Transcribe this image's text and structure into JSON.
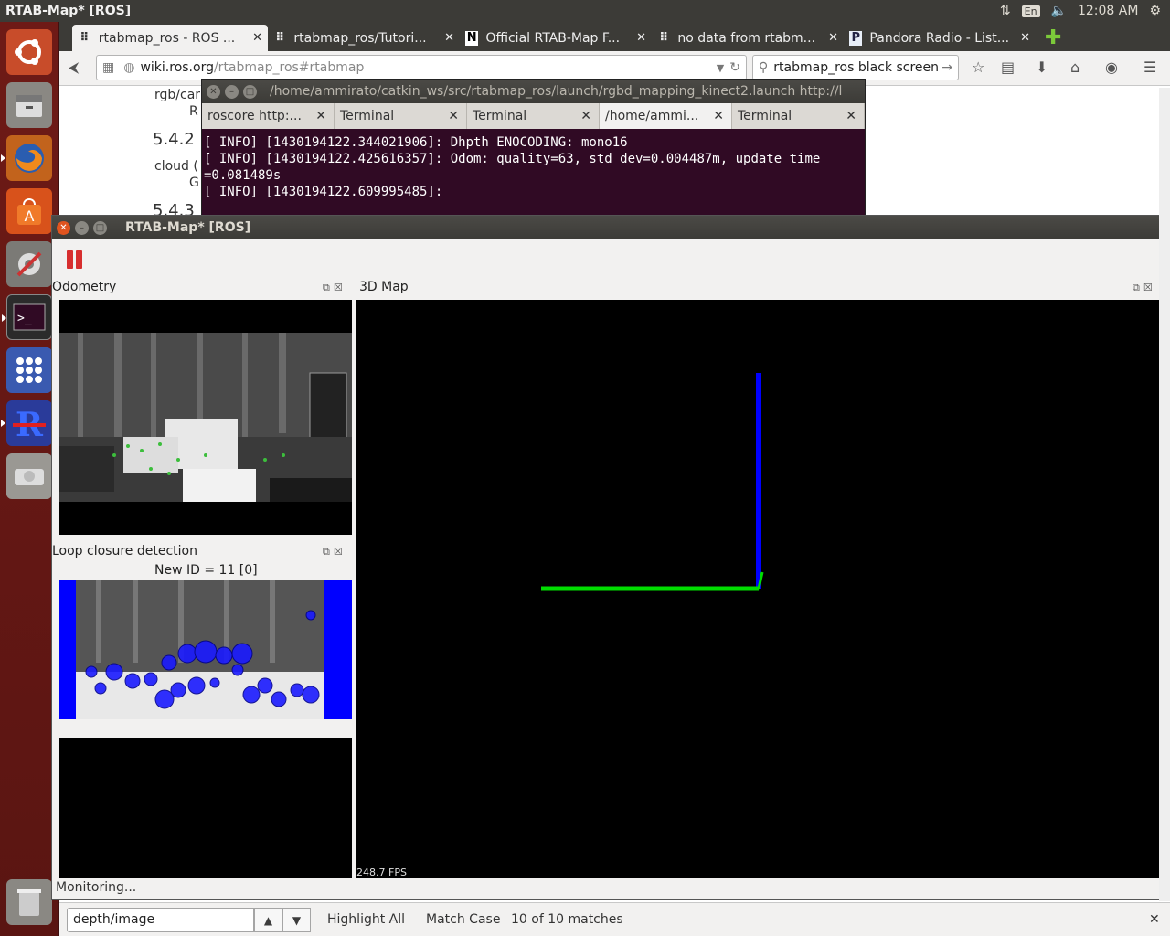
{
  "top_panel": {
    "app_title": "RTAB-Map* [ROS]",
    "keyboard": "En",
    "time": "12:08 AM"
  },
  "browser": {
    "tabs": [
      {
        "label": "rtabmap_ros - ROS ...",
        "icon": "ros-grid-icon"
      },
      {
        "label": "rtabmap_ros/Tutori...",
        "icon": "ros-grid-icon"
      },
      {
        "label": "Official RTAB-Map F...",
        "icon": "nabble-icon"
      },
      {
        "label": "no data from rtabm...",
        "icon": "ros-grid-icon"
      },
      {
        "label": "Pandora Radio - List...",
        "icon": "pandora-icon"
      }
    ],
    "url": "wiki.ros.org/rtabmap_ros#rtabmap",
    "url_domain": "wiki.ros.org",
    "url_path": "/rtabmap_ros#rtabmap",
    "search_value": "rtabmap_ros black screen",
    "page_fragments": [
      "rgb/car",
      "R",
      "5.4.2 F",
      "cloud (",
      "G",
      "5.4.3 F"
    ]
  },
  "terminal": {
    "title": "/home/ammirato/catkin_ws/src/rtabmap_ros/launch/rgbd_mapping_kinect2.launch http://l",
    "tabs": [
      "roscore http:...",
      "Terminal",
      "Terminal",
      "/home/ammi...",
      "Terminal"
    ],
    "lines": [
      "[ INFO] [1430194122.344021906]: Dhpth ENOCODING: mono16",
      "[ INFO] [1430194122.425616357]: Odom: quality=63, std dev=0.004487m, update time",
      "=0.081489s",
      "[ INFO] [1430194122.609995485]:"
    ]
  },
  "rtabmap": {
    "title": "RTAB-Map* [ROS]",
    "odometry_title": "Odometry",
    "loop_title": "Loop closure detection",
    "new_id": "New ID = 11 [0]",
    "map_title": "3D Map",
    "fps": "248.7 FPS",
    "status": "Monitoring..."
  },
  "findbar": {
    "value": "depth/image",
    "highlight_all": "Highlight All",
    "match_case": "Match Case",
    "matches": "10 of 10 matches"
  },
  "colors": {
    "axis_x": "#00dd00",
    "axis_z": "#0000ff",
    "feature": "#0000ff"
  }
}
